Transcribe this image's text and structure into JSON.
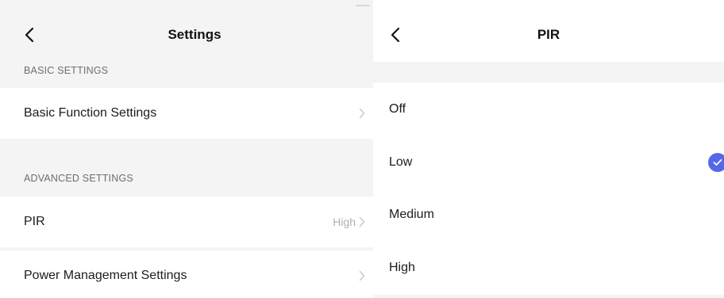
{
  "settings": {
    "title": "Settings",
    "back_icon": "chevron-left-icon",
    "basic_header": "BASIC SETTINGS",
    "basic_function": {
      "label": "Basic Function Settings",
      "icon": "chevron-right-icon"
    },
    "advanced_header": "ADVANCED SETTINGS",
    "pir": {
      "label": "PIR",
      "value": "High",
      "icon": "chevron-right-icon"
    },
    "power": {
      "label": "Power Management Settings",
      "icon": "chevron-right-icon"
    }
  },
  "pir_screen": {
    "title": "PIR",
    "back_icon": "chevron-left-icon",
    "options": [
      {
        "label": "Off",
        "selected": false
      },
      {
        "label": "Low",
        "selected": true
      },
      {
        "label": "Medium",
        "selected": false
      },
      {
        "label": "High",
        "selected": false
      }
    ],
    "check_icon": "checkmark-circle-icon",
    "accent_color": "#5468e8"
  }
}
